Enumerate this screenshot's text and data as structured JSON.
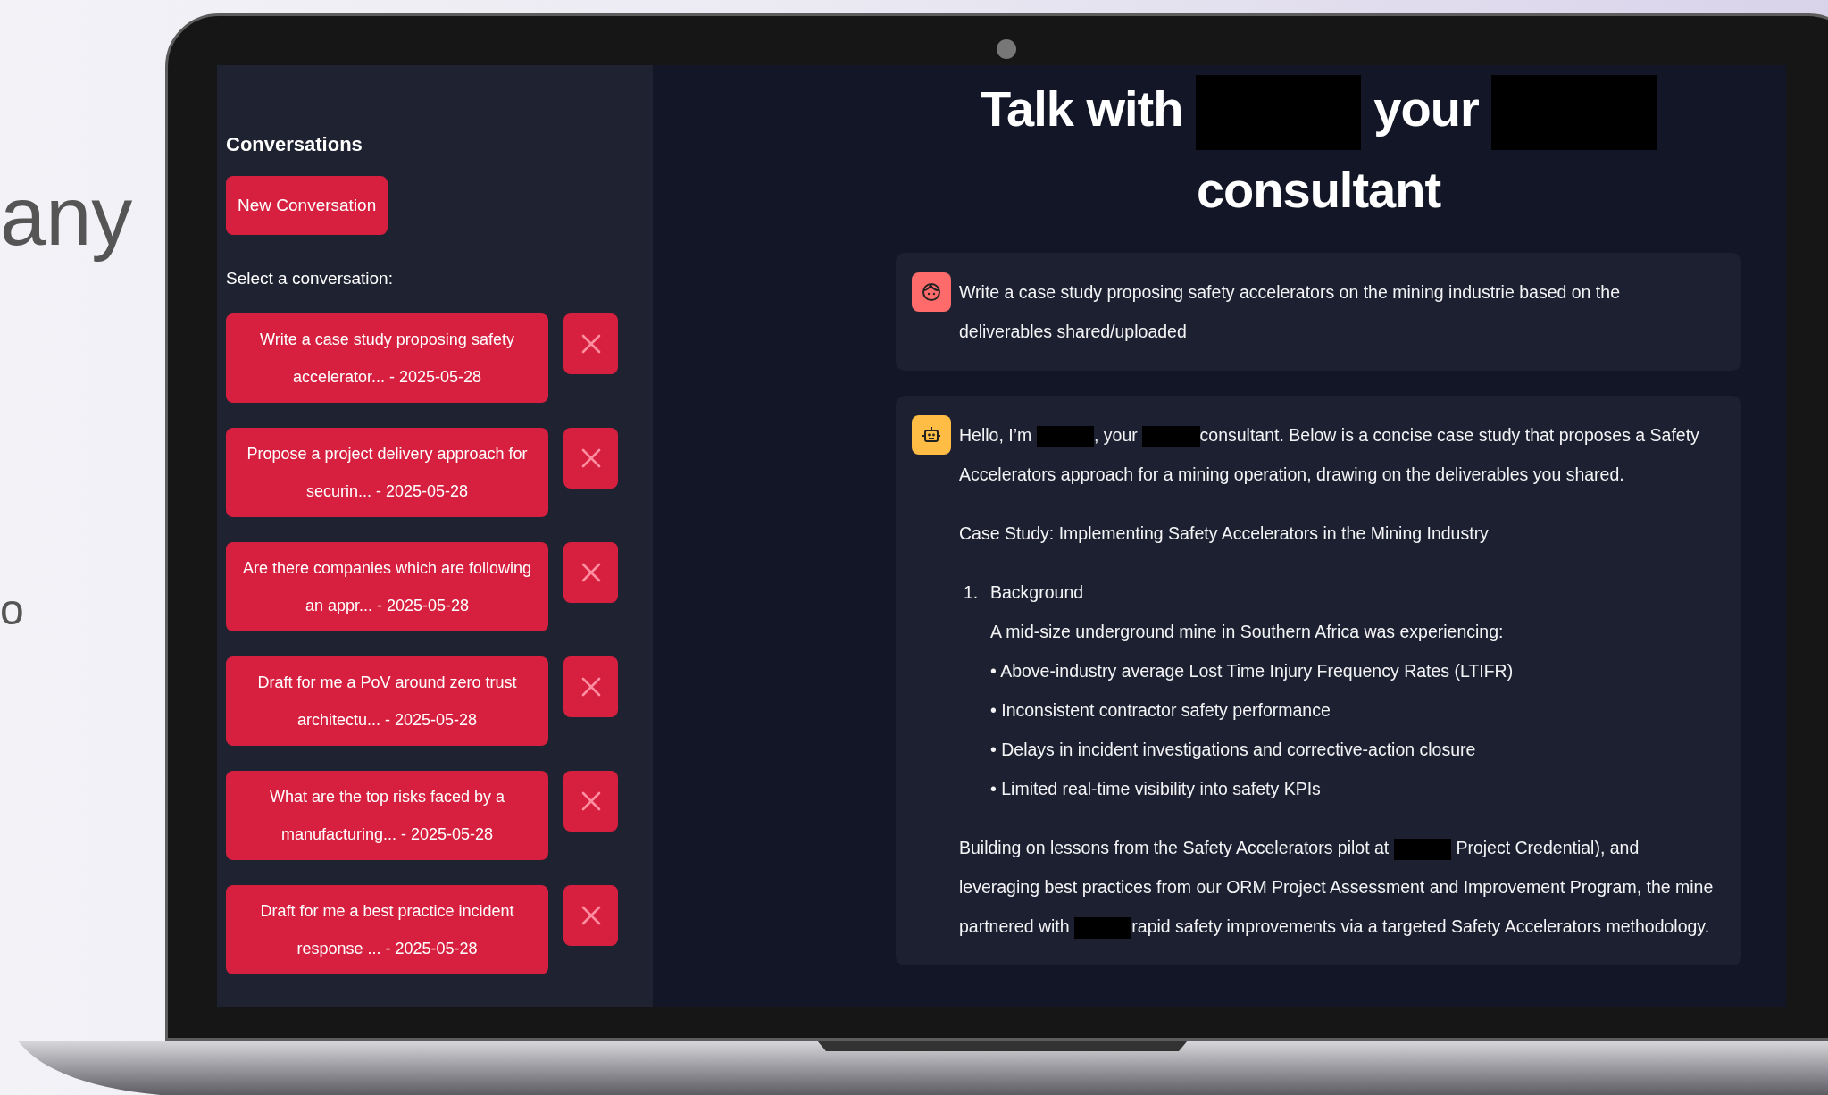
{
  "background_text": [
    "any",
    "o"
  ],
  "sidebar": {
    "heading": "Conversations",
    "new_button": "New Conversation",
    "select_label": "Select a conversation:",
    "conversations": [
      {
        "label": "Write a case study proposing safety accelerator... - 2025-05-28"
      },
      {
        "label": "Propose a project delivery approach for securin... - 2025-05-28"
      },
      {
        "label": "Are there companies which are following an appr... - 2025-05-28"
      },
      {
        "label": "Draft for me a PoV around zero trust architectu... - 2025-05-28"
      },
      {
        "label": "What are the top risks faced by a manufacturing... - 2025-05-28"
      },
      {
        "label": "Draft for me a best practice incident response ... - 2025-05-28"
      }
    ]
  },
  "title": {
    "lines": [
      [
        {
          "kind": "text",
          "text": "Talk with "
        },
        {
          "kind": "redacted"
        },
        {
          "kind": "text",
          "text": " your "
        },
        {
          "kind": "redacted"
        }
      ],
      [
        {
          "kind": "text",
          "text": "consultant"
        }
      ]
    ]
  },
  "messages": [
    {
      "kind": "user",
      "blocks": [
        {
          "kind": "paragraph",
          "segments": [
            {
              "kind": "text",
              "text": "Write a case study proposing safety accelerators on the mining industrie based on the deliverables shared/uploaded"
            }
          ]
        }
      ]
    },
    {
      "kind": "assistant",
      "blocks": [
        {
          "kind": "paragraph",
          "segments": [
            {
              "kind": "text",
              "text": "Hello, I’m "
            },
            {
              "kind": "redacted"
            },
            {
              "kind": "text",
              "text": ", your "
            },
            {
              "kind": "redacted"
            },
            {
              "kind": "text",
              "text": "consultant. Below is a concise case study that proposes a Safety Accelerators approach for a mining operation, drawing on the deliverables you shared."
            }
          ]
        },
        {
          "kind": "paragraph",
          "segments": [
            {
              "kind": "text",
              "text": "Case Study: Implementing Safety Accelerators in the Mining Industry"
            }
          ]
        },
        {
          "kind": "numbered",
          "number": "1.",
          "title": "Background",
          "lines": [
            "A mid-size underground mine in Southern Africa was experiencing:",
            "• Above-industry average Lost Time Injury Frequency Rates (LTIFR)",
            "• Inconsistent contractor safety performance",
            "• Delays in incident investigations and corrective-action closure",
            "• Limited real-time visibility into safety KPIs"
          ]
        },
        {
          "kind": "paragraph",
          "segments": [
            {
              "kind": "text",
              "text": "Building on lessons from the Safety Accelerators pilot at "
            },
            {
              "kind": "redacted"
            },
            {
              "kind": "text",
              "text": " Project Credential), and leveraging best practices from our ORM Project Assessment and Improvement Program, the mine partnered with "
            },
            {
              "kind": "redacted"
            },
            {
              "kind": "text",
              "text": "rapid safety improvements via a targeted Safety Accelerators methodology."
            }
          ]
        }
      ]
    }
  ]
}
